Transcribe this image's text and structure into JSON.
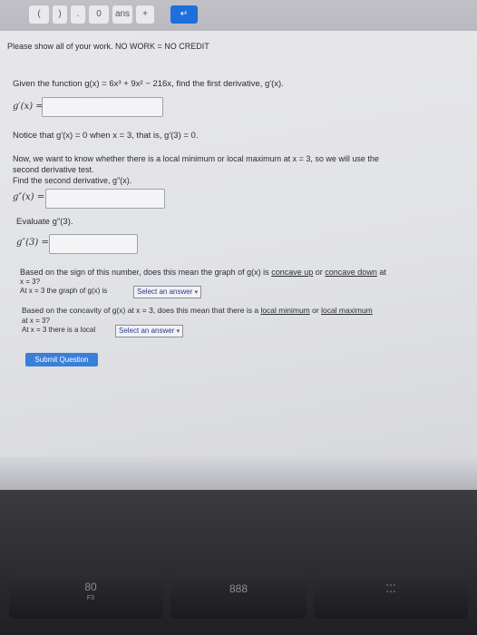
{
  "toolbar": {
    "back": "(",
    "forward": ")",
    "dot": ".",
    "zero": "0",
    "ans": "ans",
    "plus": "+",
    "enter": "↵"
  },
  "header": {
    "instructions": "Please show all of your work. NO WORK = NO CREDIT"
  },
  "q1": {
    "prompt": "Given the function g(x) = 6x³ + 9x² − 216x, find the first derivative, g′(x).",
    "label": "g′(x) ="
  },
  "notice": "Notice that g′(x) = 0 when x = 3, that is, g′(3) = 0.",
  "q2": {
    "line1": "Now, we want to know whether there is a local minimum or local maximum at x = 3, so we will use the",
    "line2": "second derivative test.",
    "line3": "Find the second derivative, g″(x).",
    "label": "g″(x) ="
  },
  "q3": {
    "prompt": "Evaluate g″(3).",
    "label": "g″(3) ="
  },
  "q4": {
    "line1_pre": "Based on the sign of this number, does this mean the graph of g(x) is",
    "concave_up": "concave up",
    "or": "or",
    "concave_down": "concave down",
    "line1_post": "at",
    "line2": "x = 3?",
    "line3_pre": "At x = 3 the graph of g(x) is",
    "select_text": "Select an answer"
  },
  "q5": {
    "line1_pre": "Based on the concavity of g(x) at x = 3, does this mean that there is a",
    "local_min": "local minimum",
    "or": "or",
    "local_max": "local maximum",
    "line2": "at x = 3?",
    "line3_pre": "At x = 3 there is a local",
    "select_text": "Select an answer"
  },
  "submit": {
    "label": "Submit Question"
  },
  "keyboard": {
    "f3": "80",
    "f3_sub": "F3",
    "f4": "888",
    "f5": "⁚⁚⁚"
  }
}
